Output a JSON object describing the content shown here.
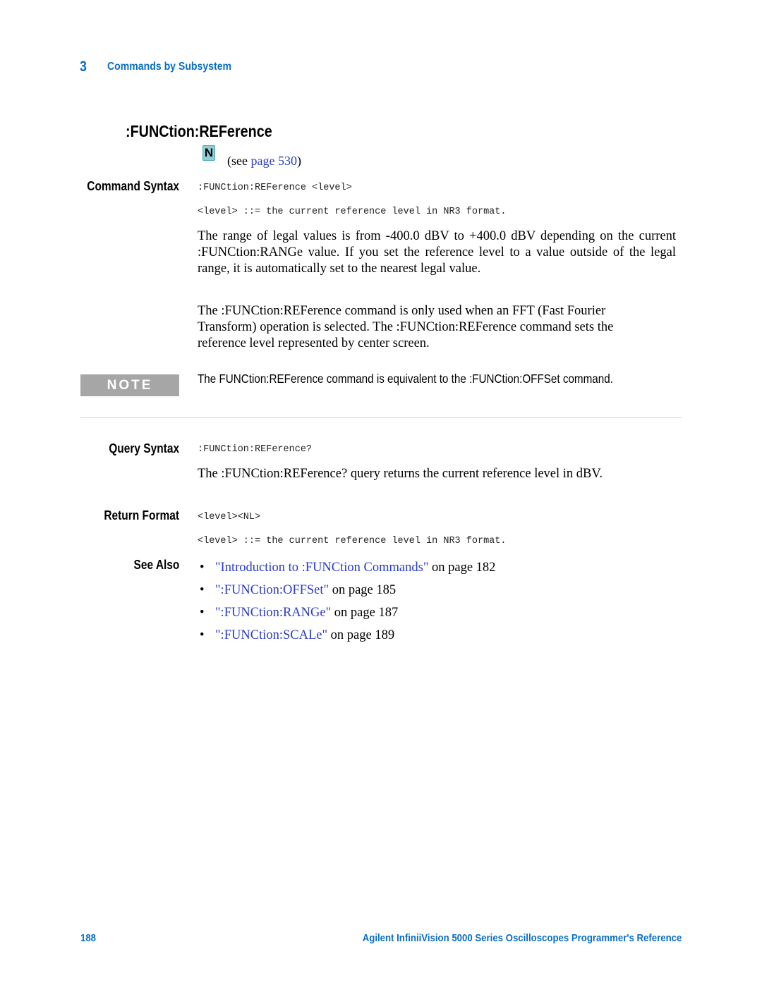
{
  "header": {
    "chapter_number": "3",
    "chapter_title": "Commands by Subsystem"
  },
  "command": {
    "title": ":FUNCtion:REFerence",
    "icon": "n-icon",
    "icon_letter": "N",
    "see_prefix": "(see ",
    "see_link": "page 530",
    "see_suffix": ")"
  },
  "command_syntax": {
    "label": "Command Syntax",
    "syntax": ":FUNCtion:REFerence <level>",
    "definition": "<level> ::= the current reference level in NR3 format.",
    "paragraphs": [
      "The range of legal values is from -400.0 dBV to +400.0 dBV depending on the current :FUNCtion:RANGe value. If you set the reference level to a value outside of the legal range, it is automatically set to the nearest legal value.",
      "The :FUNCtion:REFerence command is only used when an FFT (Fast Fourier Transform) operation is selected. The :FUNCtion:REFerence command sets the reference level represented by center screen."
    ]
  },
  "note": {
    "badge": "NOTE",
    "text": "The FUNCtion:REFerence command is equivalent to the :FUNCtion:OFFSet command."
  },
  "query_syntax": {
    "label": "Query Syntax",
    "syntax": ":FUNCtion:REFerence?",
    "paragraph": "The :FUNCtion:REFerence? query returns the current reference level in dBV."
  },
  "return_format": {
    "label": "Return Format",
    "format": "<level><NL>",
    "definition": "<level> ::= the current reference level in NR3 format."
  },
  "see_also": {
    "label": "See Also",
    "bullet": "•",
    "items": [
      {
        "link": "\"Introduction to :FUNCtion Commands\"",
        "suffix": " on page 182"
      },
      {
        "link": "\":FUNCtion:OFFSet\"",
        "suffix": " on page 185"
      },
      {
        "link": "\":FUNCtion:RANGe\"",
        "suffix": " on page 187"
      },
      {
        "link": "\":FUNCtion:SCALe\"",
        "suffix": " on page 189"
      }
    ]
  },
  "footer": {
    "page_number": "188",
    "book_title": "Agilent InfiniiVision 5000 Series Oscilloscopes Programmer's Reference"
  },
  "colors": {
    "accent_blue": "#0a6ec5",
    "link_blue": "#2a3bc8",
    "note_badge_gray": "#a6a6a6",
    "n_icon_teal": "#8fd0d8"
  }
}
